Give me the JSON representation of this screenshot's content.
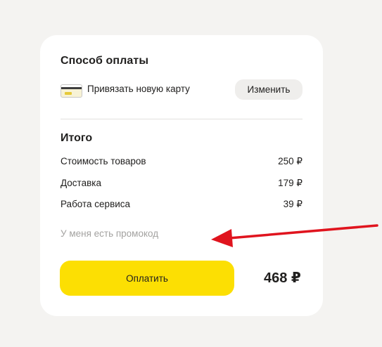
{
  "payment": {
    "title": "Способ оплаты",
    "card_icon": "bank-card-icon",
    "link_card_label": "Привязать новую карту",
    "change_label": "Изменить"
  },
  "summary": {
    "title": "Итого",
    "items": [
      {
        "label": "Стоимость товаров",
        "value": "250 ₽"
      },
      {
        "label": "Доставка",
        "value": "179 ₽"
      },
      {
        "label": "Работа сервиса",
        "value": "39 ₽"
      }
    ],
    "promo_label": "У меня есть промокод",
    "pay_label": "Оплатить",
    "total": "468 ₽"
  },
  "colors": {
    "pay_button": "#fcdf03",
    "annotation_arrow": "#e0141e"
  },
  "annotation": {
    "icon": "red-arrow-icon"
  }
}
